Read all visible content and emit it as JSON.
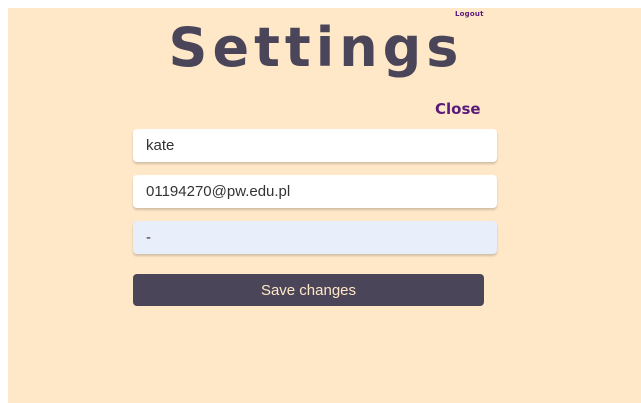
{
  "header": {
    "logout_label": "Logout",
    "title": "Settings",
    "close_label": "Close"
  },
  "form": {
    "name_value": "kate",
    "email_value": "01194270@pw.edu.pl",
    "password_value": "-",
    "save_label": "Save changes"
  },
  "colors": {
    "background": "#ffe8c7",
    "accent": "#5a1a7a",
    "primary": "#4a4558",
    "autofill": "#e8eefa"
  }
}
